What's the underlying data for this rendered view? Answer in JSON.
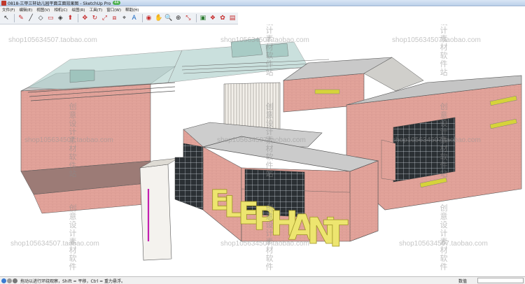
{
  "window": {
    "title": "0818-三甲三轩幼儿园平面立面效果图 - SketchUp Pro",
    "badge": "44"
  },
  "menubar": {
    "items": [
      "文件(F)",
      "编辑(E)",
      "视图(V)",
      "相机(C)",
      "绘图(R)",
      "工具(T)",
      "窗口(W)",
      "帮助(H)"
    ]
  },
  "toolbar": {
    "tools": [
      {
        "icon": "select-arrow-icon",
        "glyph": "↖",
        "tone": ""
      },
      {
        "icon": "pencil-icon",
        "glyph": "✎",
        "tone": "red"
      },
      {
        "icon": "line-icon",
        "glyph": "╱",
        "tone": ""
      },
      {
        "icon": "shape-icon",
        "glyph": "◇",
        "tone": ""
      },
      {
        "icon": "eraser-icon",
        "glyph": "▭",
        "tone": "red"
      },
      {
        "icon": "paint-bucket-icon",
        "glyph": "◈",
        "tone": ""
      },
      {
        "icon": "push-pull-icon",
        "glyph": "⬆",
        "tone": "red"
      },
      {
        "icon": "move-icon",
        "glyph": "✥",
        "tone": "red"
      },
      {
        "icon": "rotate-icon",
        "glyph": "↻",
        "tone": "red"
      },
      {
        "icon": "scale-icon",
        "glyph": "⤢",
        "tone": "red"
      },
      {
        "icon": "offset-icon",
        "glyph": "⧈",
        "tone": "red"
      },
      {
        "icon": "tape-measure-icon",
        "glyph": "⌖",
        "tone": ""
      },
      {
        "icon": "text-icon",
        "glyph": "A",
        "tone": "blue"
      },
      {
        "icon": "orbit-icon",
        "glyph": "◉",
        "tone": "red"
      },
      {
        "icon": "pan-icon",
        "glyph": "✋",
        "tone": ""
      },
      {
        "icon": "zoom-icon",
        "glyph": "🔍",
        "tone": ""
      },
      {
        "icon": "zoom-window-icon",
        "glyph": "⊕",
        "tone": ""
      },
      {
        "icon": "zoom-extents-icon",
        "glyph": "⤡",
        "tone": "red"
      },
      {
        "icon": "warehouse-icon",
        "glyph": "▣",
        "tone": "green"
      },
      {
        "icon": "components-icon",
        "glyph": "❖",
        "tone": "red"
      },
      {
        "icon": "extension-icon",
        "glyph": "✿",
        "tone": "red"
      },
      {
        "icon": "layout-icon",
        "glyph": "▤",
        "tone": "red"
      }
    ]
  },
  "watermarks": {
    "shop": "shop105634507.taobao.com",
    "vertical": "创意设计素材软件站",
    "vertical_short": "创意设计素材软件"
  },
  "model": {
    "sign_text": "ELEPHANT"
  },
  "statusbar": {
    "hint": "拖动以进行环绕观察，Shift = 平移，Ctrl = 重力悬浮。",
    "measure_label": "数值",
    "measure_value": ""
  }
}
